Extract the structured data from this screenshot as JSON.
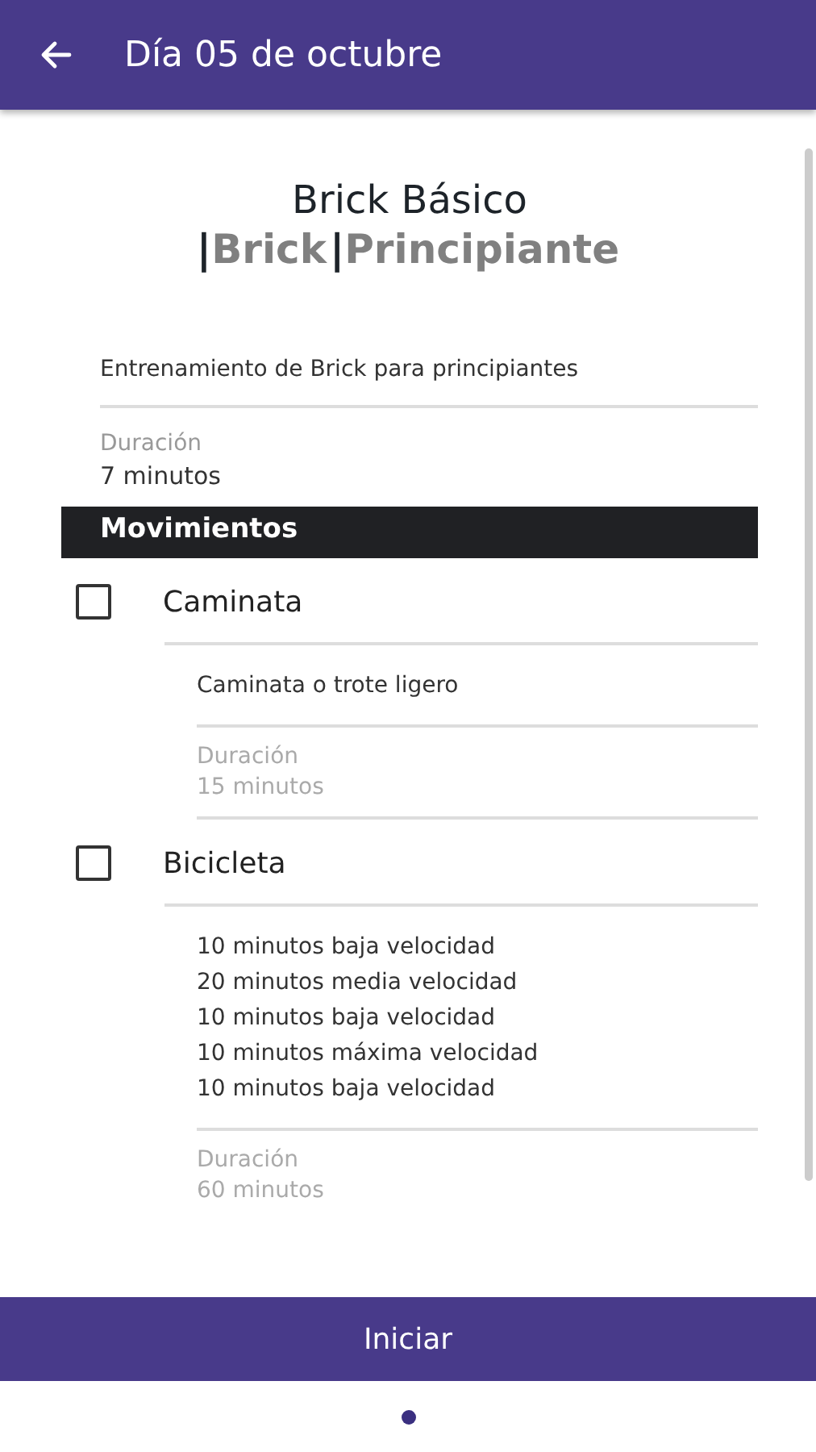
{
  "app_bar": {
    "title": "Día 05 de octubre"
  },
  "workout": {
    "title": "Brick Básico",
    "tags": [
      {
        "separator": "|",
        "label": "Brick"
      },
      {
        "separator": "|",
        "label": "Principiante"
      }
    ],
    "description": "Entrenamiento de Brick para principiantes",
    "duration_label": "Duración",
    "duration": "7 minutos"
  },
  "section": {
    "title": "Movimientos"
  },
  "movements": [
    {
      "name": "Caminata",
      "checked": false,
      "description_lines": [
        "Caminata o trote ligero"
      ],
      "duration_label": "Duración",
      "duration": "15 minutos"
    },
    {
      "name": "Bicicleta",
      "checked": false,
      "description_lines": [
        "10 minutos baja velocidad",
        "20 minutos media velocidad",
        "10 minutos baja velocidad",
        "10 minutos máxima velocidad",
        "10 minutos baja velocidad"
      ],
      "duration_label": "Duración",
      "duration": "60 minutos"
    }
  ],
  "start_button": {
    "label": "Iniciar"
  },
  "page_indicator": [
    {
      "selected": true
    }
  ]
}
